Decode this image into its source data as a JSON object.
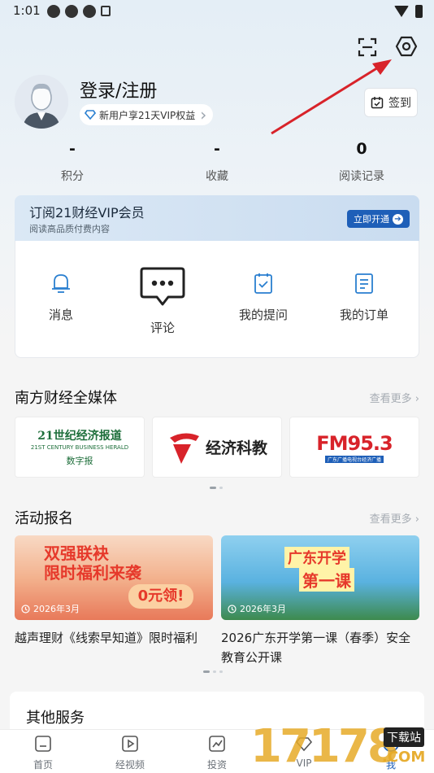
{
  "status_bar": {
    "time": "1:01"
  },
  "profile": {
    "login_title": "登录/注册",
    "vip_promo": "新用户享21天VIP权益",
    "checkin_label": "签到"
  },
  "stats": [
    {
      "value": "-",
      "label": "积分"
    },
    {
      "value": "-",
      "label": "收藏"
    },
    {
      "value": "0",
      "label": "阅读记录"
    }
  ],
  "vip_banner": {
    "title": "订阅21财经VIP会员",
    "subtitle": "阅读高品质付费内容",
    "button": "立即开通"
  },
  "quick_actions": [
    {
      "label": "消息",
      "icon": "bell-icon"
    },
    {
      "label": "评论",
      "icon": "comment-icon"
    },
    {
      "label": "我的提问",
      "icon": "question-icon"
    },
    {
      "label": "我的订单",
      "icon": "order-icon"
    }
  ],
  "media_section": {
    "title": "南方财经全媒体",
    "see_more": "查看更多",
    "cards": [
      {
        "line1": "21世纪经济报道",
        "line2": "21ST CENTURY BUSINESS HERALD",
        "line3": "数字报"
      },
      {
        "line1": "经济科教"
      },
      {
        "line1": "FM95.3",
        "line2": "广东广播电视台经济广播"
      }
    ]
  },
  "activity_section": {
    "title": "活动报名",
    "see_more": "查看更多",
    "items": [
      {
        "date": "2026年3月",
        "title": "越声理财《线索早知道》限时福利",
        "banner_line1": "双强联袂",
        "banner_line2": "限时福利来袭",
        "banner_badge": "0元领!"
      },
      {
        "date": "2026年3月",
        "title": "2026广东开学第一课（春季）安全教育公开课",
        "banner_line1": "广东开学",
        "banner_line2": "第一课"
      }
    ]
  },
  "other_services": {
    "title": "其他服务"
  },
  "bottom_nav": [
    {
      "label": "首页",
      "icon": "home-icon"
    },
    {
      "label": "经视频",
      "icon": "video-icon"
    },
    {
      "label": "投资",
      "icon": "chart-icon"
    },
    {
      "label": "VIP",
      "icon": "vip-icon"
    },
    {
      "label": "我",
      "icon": "profile-icon"
    }
  ],
  "watermark": {
    "text": "17178",
    "sub": "下载站",
    "domain": ".COM"
  },
  "colors": {
    "accent_blue": "#1e5fb8",
    "arrow_red": "#d8232a"
  }
}
